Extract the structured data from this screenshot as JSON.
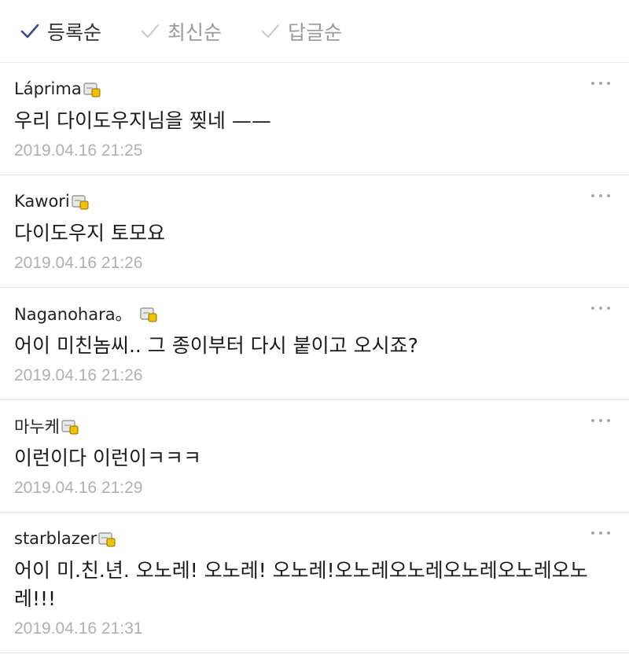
{
  "sort": {
    "tabs": [
      {
        "label": "등록순",
        "active": true
      },
      {
        "label": "최신순",
        "active": false
      },
      {
        "label": "답글순",
        "active": false
      }
    ]
  },
  "comments": [
    {
      "author": "Láprima",
      "text": "우리 다이도우지님을 찢네 ——",
      "date": "2019.04.16 21:25"
    },
    {
      "author": "Kawori",
      "text": "다이도우지 토모요",
      "date": "2019.04.16 21:26"
    },
    {
      "author": "Naganohara。",
      "text": "어이 미친놈씨.. 그 종이부터 다시 붙이고 오시죠?",
      "date": "2019.04.16 21:26"
    },
    {
      "author": "마누케",
      "text": "이런이다 이런이ㅋㅋㅋ",
      "date": "2019.04.16 21:29"
    },
    {
      "author": "starblazer",
      "text": "어이 미.친.년. 오노레! 오노레! 오노레!오노레오노레오노레오노레오노레!!!",
      "date": "2019.04.16 21:31"
    }
  ],
  "colors": {
    "active_check": "#3a4a8c",
    "inactive_check": "#c8c8c8",
    "date": "#b0b0b0",
    "divider": "#e6e6e6"
  },
  "icons": {
    "check": "check-icon",
    "badge": "member-badge-icon",
    "more": "more-options-icon"
  }
}
